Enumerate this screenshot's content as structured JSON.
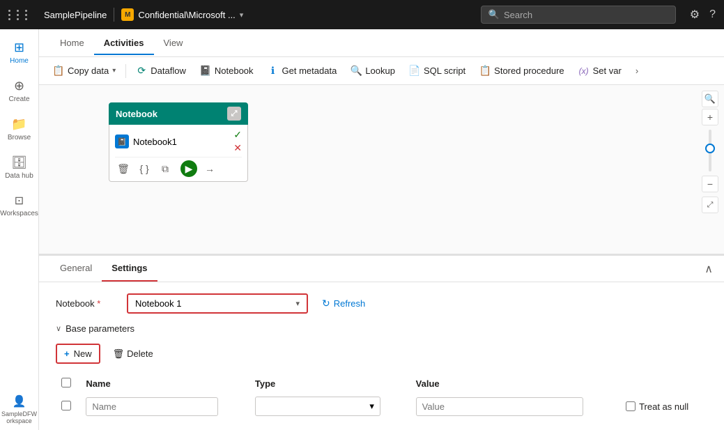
{
  "topbar": {
    "grid_label": "apps",
    "pipeline_title": "SamplePipeline",
    "workspace_icon_text": "M",
    "workspace_name": "Confidential\\Microsoft ...",
    "search_placeholder": "Search",
    "settings_icon": "⚙",
    "help_icon": "?"
  },
  "sidebar": {
    "items": [
      {
        "label": "Home",
        "icon": "⊞"
      },
      {
        "label": "Create",
        "icon": "+"
      },
      {
        "label": "Browse",
        "icon": "📁"
      },
      {
        "label": "Data hub",
        "icon": "🗄"
      },
      {
        "label": "Workspaces",
        "icon": "⊡"
      },
      {
        "label": "SampleDFW orkspace",
        "icon": "👤"
      }
    ]
  },
  "nav_tabs": [
    {
      "label": "Home",
      "active": false
    },
    {
      "label": "Activities",
      "active": true
    },
    {
      "label": "View",
      "active": false
    }
  ],
  "toolbar": {
    "buttons": [
      {
        "label": "Copy data",
        "icon": "📋",
        "has_dropdown": true
      },
      {
        "label": "Dataflow",
        "icon": "⟳"
      },
      {
        "label": "Notebook",
        "icon": "📓"
      },
      {
        "label": "Get metadata",
        "icon": "ℹ"
      },
      {
        "label": "Lookup",
        "icon": "🔍"
      },
      {
        "label": "SQL script",
        "icon": "📄"
      },
      {
        "label": "Stored procedure",
        "icon": "📋"
      },
      {
        "label": "Set var",
        "icon": "(x)"
      }
    ],
    "more_label": "›"
  },
  "pipeline": {
    "node": {
      "header": "Notebook",
      "activity_name": "Notebook1",
      "activity_icon": "📓"
    }
  },
  "bottom_panel": {
    "tabs": [
      {
        "label": "General",
        "active": false
      },
      {
        "label": "Settings",
        "active": true
      }
    ],
    "notebook_label": "Notebook",
    "notebook_required": "*",
    "notebook_value": "Notebook 1",
    "refresh_label": "Refresh",
    "base_params_label": "Base parameters",
    "new_label": "+ New",
    "delete_label": "Delete",
    "table": {
      "headers": [
        "",
        "Name",
        "Type",
        "Value",
        ""
      ],
      "row": {
        "name_placeholder": "Name",
        "type_placeholder": "",
        "value_placeholder": "Value",
        "treat_null_label": "Treat as null"
      }
    }
  }
}
